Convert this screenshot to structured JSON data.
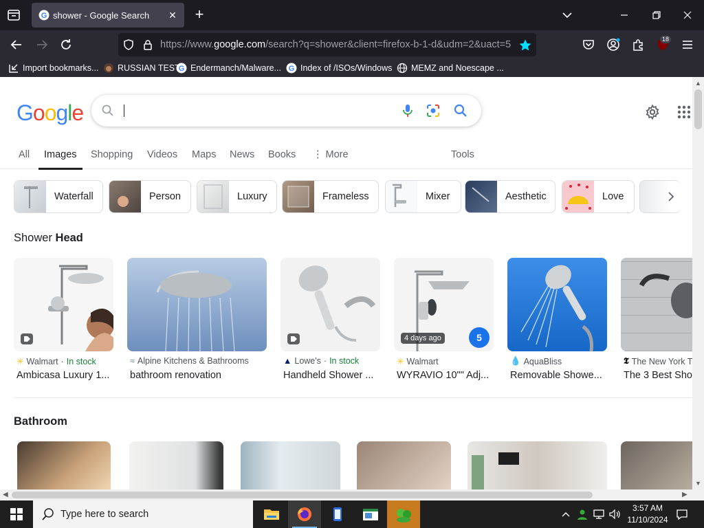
{
  "browser": {
    "tab_title": "shower - Google Search",
    "url_prefix": "https://www.",
    "url_domain": "google.com",
    "url_path": "/search?q=shower&client=firefox-b-1-d&udm=2&uact=5",
    "extension_badge": "18",
    "bookmarks": [
      {
        "label": "Import bookmarks...",
        "icon": "import-icon"
      },
      {
        "label": "RUSSIAN TEST",
        "icon": "cat-icon"
      },
      {
        "label": "Endermanch/Malware...",
        "icon": "google-icon"
      },
      {
        "label": "Index of /ISOs/Windows",
        "icon": "google-icon"
      },
      {
        "label": "MEMZ and Noescape ...",
        "icon": "globe-icon"
      }
    ]
  },
  "google": {
    "logo_text": "Google",
    "search": {
      "value": "",
      "placeholder": ""
    },
    "tabs": [
      "All",
      "Images",
      "Shopping",
      "Videos",
      "Maps",
      "News",
      "Books",
      "More"
    ],
    "active_tab": "Images",
    "tools_label": "Tools",
    "chips": [
      "Waterfall",
      "Person",
      "Luxury",
      "Frameless",
      "Mixer",
      "Aesthetic",
      "Love"
    ],
    "sections": [
      {
        "prefix": "Shower ",
        "bold": "Head"
      },
      {
        "prefix": "",
        "bold": "Bathroom"
      }
    ],
    "results": [
      {
        "source": "Walmart",
        "stock": "In stock",
        "title": "Ambicasa Luxury 1...",
        "tag": "product-tag-icon",
        "age": ""
      },
      {
        "source": "Alpine Kitchens & Bathrooms",
        "stock": "",
        "title": "bathroom renovation",
        "tag": "",
        "age": ""
      },
      {
        "source": "Lowe's",
        "stock": "In stock",
        "title": "Handheld Shower ...",
        "tag": "product-tag-icon",
        "age": ""
      },
      {
        "source": "Walmart",
        "stock": "",
        "title": "WYRAVIO 10\"\" Adj...",
        "tag": "",
        "age": "4 days ago"
      },
      {
        "source": "AquaBliss",
        "stock": "",
        "title": "Removable Showe...",
        "tag": "",
        "age": ""
      },
      {
        "source": "The New York T",
        "stock": "",
        "title": "The 3 Best Sho",
        "tag": "",
        "age": ""
      }
    ],
    "stock_sep": " · "
  },
  "taskbar": {
    "search_placeholder": "Type here to search",
    "time": "3:57 AM",
    "date": "11/10/2024"
  },
  "colors": {
    "google_blue": "#4285f4",
    "google_red": "#ea4335",
    "google_yellow": "#fbbc05",
    "google_green": "#34a853",
    "firefox_star": "#00ddff",
    "taskbar_accent": "#c77a1e"
  }
}
